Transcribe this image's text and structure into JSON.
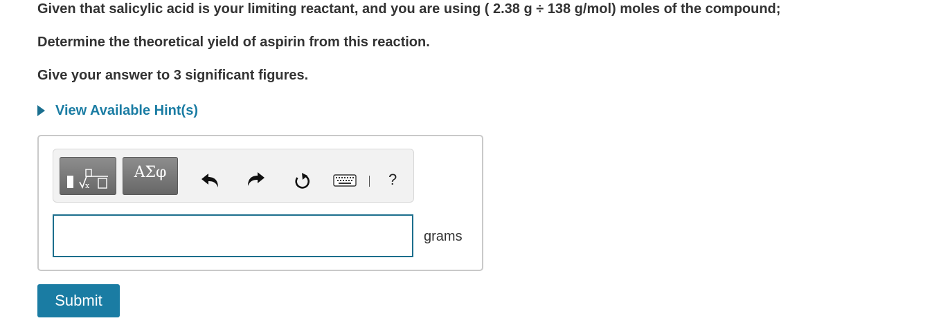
{
  "question": {
    "line1": "Given that salicylic acid is your limiting reactant, and you are using (  2.38 g ÷ 138 g/mol) moles of the compound;",
    "line2": "Determine the theoretical yield of aspirin from this reaction.",
    "line3": "Give your answer to 3 significant figures."
  },
  "hint": {
    "label": "View Available Hint(s)",
    "icon": "triangle-right-icon",
    "color": "#1a7ca3"
  },
  "toolbar": {
    "templates_icon": "templates-icon",
    "symbols_label": "ΑΣφ",
    "undo_icon": "undo-icon",
    "redo_icon": "redo-icon",
    "reset_icon": "reset-icon",
    "keyboard_icon": "keyboard-icon",
    "help_label": "?"
  },
  "answer": {
    "value": "",
    "unit": "grams"
  },
  "submit": {
    "label": "Submit",
    "color": "#1a7ca3"
  }
}
